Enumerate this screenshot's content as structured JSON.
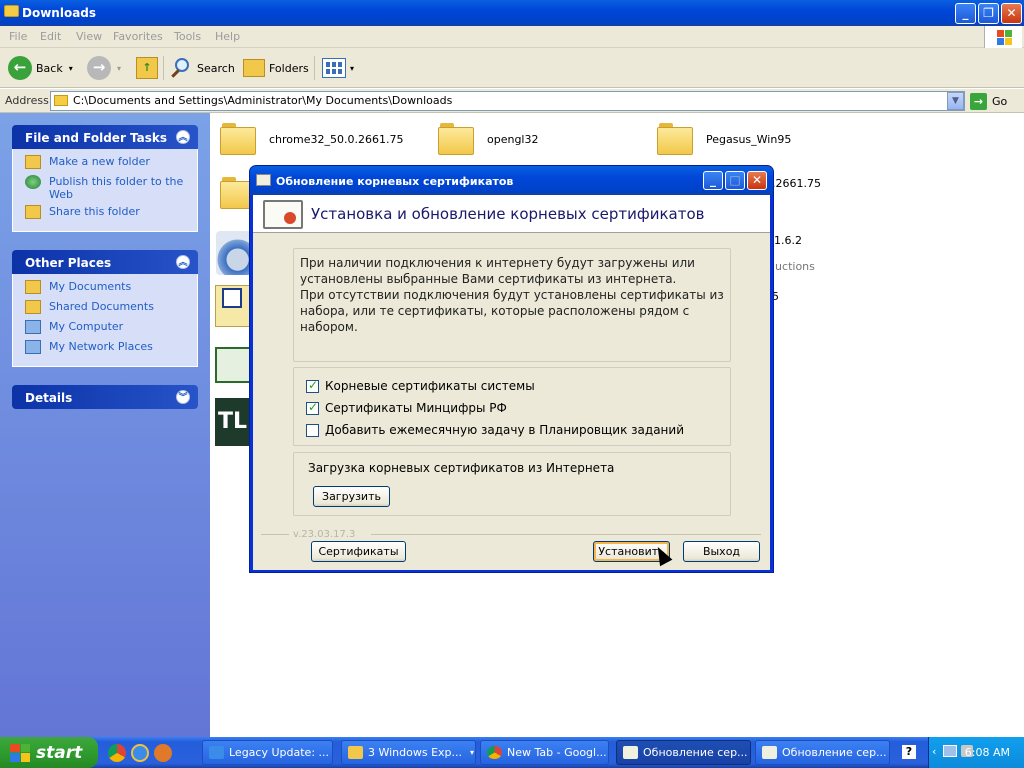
{
  "window": {
    "title": "Downloads",
    "buttons": [
      "_",
      "❐",
      "✕"
    ]
  },
  "menu": [
    "File",
    "Edit",
    "View",
    "Favorites",
    "Tools",
    "Help"
  ],
  "toolbar": {
    "back_label": "Back",
    "search_label": "Search",
    "folders_label": "Folders"
  },
  "address": {
    "label": "Address",
    "path": "C:\\Documents and Settings\\Administrator\\My Documents\\Downloads",
    "go_label": "Go"
  },
  "sidebar": {
    "tasks_title": "File and Folder Tasks",
    "tasks": [
      "Make a new folder",
      "Publish this folder to the Web",
      "Share this folder"
    ],
    "places_title": "Other Places",
    "places": [
      "My Documents",
      "Shared Documents",
      "My Computer",
      "My Network Places"
    ],
    "details_title": "Details"
  },
  "files": {
    "f1": "chrome32_50.0.2661.75",
    "f2": "opengl32",
    "f3": "Pegasus_Win95",
    "f4": ".2661.75",
    "f5": "-1.6.2",
    "f6": "luctions",
    "f7": "5",
    "tl_icon_text": "TL"
  },
  "dialog": {
    "title": "Обновление корневых сертификатов",
    "banner": "Установка и обновление корневых сертификатов",
    "info_lines": [
      "При наличии подключения к интернету будут загружены или",
      "установлены выбранные Вами сертификаты из интернета.",
      "При отсутствии подключения будут установлены сертификаты из",
      "набора, или те сертификаты, которые расположены рядом с набором."
    ],
    "checks": [
      {
        "label": "Корневые сертификаты системы",
        "checked": true
      },
      {
        "label": "Сертификаты Минцифры РФ",
        "checked": true
      },
      {
        "label": "Добавить ежемесячную задачу в Планировщик заданий",
        "checked": false
      }
    ],
    "load_title": "Загрузка корневых сертификатов из Интернета",
    "load_button": "Загрузить",
    "version": "v.23.03.17.3",
    "certs_button": "Сертификаты",
    "install_button": "Установить",
    "exit_button": "Выход"
  },
  "taskbar": {
    "start": "start",
    "tasks": [
      {
        "label": "Legacy Update: ..."
      },
      {
        "label": "3 Windows Exp..."
      },
      {
        "label": "New Tab - Googl..."
      },
      {
        "label": "Обновление сер..."
      },
      {
        "label": "Обновление сер..."
      }
    ],
    "clock": "6:08 AM"
  }
}
